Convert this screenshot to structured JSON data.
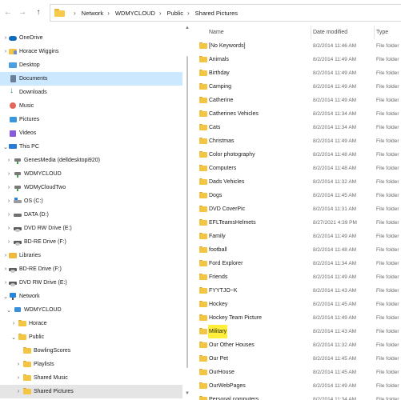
{
  "address_bar": {
    "back_icon": "back-arrow-icon",
    "forward_icon": "forward-arrow-icon",
    "up_icon": "up-arrow-icon",
    "crumbs": [
      "Network",
      "WDMYCLOUD",
      "Public",
      "Shared Pictures"
    ]
  },
  "navigation": {
    "items": [
      {
        "label": "OneDrive",
        "icon": "onedrive-icon"
      },
      {
        "label": "Horace Wiggins",
        "icon": "user-folder-icon"
      },
      {
        "label": "Desktop",
        "icon": "desktop-icon"
      },
      {
        "label": "Documents",
        "icon": "documents-icon"
      },
      {
        "label": "Downloads",
        "icon": "downloads-icon"
      },
      {
        "label": "Music",
        "icon": "music-icon"
      },
      {
        "label": "Pictures",
        "icon": "pictures-icon"
      },
      {
        "label": "Videos",
        "icon": "videos-icon"
      },
      {
        "label": "This PC",
        "icon": "this-pc-icon"
      },
      {
        "label": "GenesMedia (delldesktopi920)",
        "icon": "network-drive-icon"
      },
      {
        "label": "WDMYCLOUD",
        "icon": "network-drive-icon"
      },
      {
        "label": "WDMyCloudTwo",
        "icon": "network-drive-icon"
      },
      {
        "label": "OS (C:)",
        "icon": "os-drive-icon"
      },
      {
        "label": "DATA (D:)",
        "icon": "drive-icon"
      },
      {
        "label": "DVD RW Drive (E:)",
        "icon": "dvd-drive-icon"
      },
      {
        "label": "BD-RE Drive (F:)",
        "icon": "dvd-drive-icon"
      },
      {
        "label": "Libraries",
        "icon": "libraries-icon"
      },
      {
        "label": "BD-RE Drive (F:)",
        "icon": "dvd-drive-icon"
      },
      {
        "label": "DVD RW Drive (E:)",
        "icon": "dvd-drive-icon"
      },
      {
        "label": "Network",
        "icon": "network-icon"
      },
      {
        "label": "WDMYCLOUD",
        "icon": "computer-icon"
      },
      {
        "label": "Horace",
        "icon": "folder-icon"
      },
      {
        "label": "Public",
        "icon": "folder-icon"
      },
      {
        "label": "BowlingScores",
        "icon": "folder-icon"
      },
      {
        "label": "Playlists",
        "icon": "folder-icon"
      },
      {
        "label": "Shared Music",
        "icon": "folder-icon"
      },
      {
        "label": "Shared Pictures",
        "icon": "folder-icon"
      }
    ]
  },
  "content": {
    "columns": {
      "name": "Name",
      "date": "Date modified",
      "type": "Type"
    },
    "files": [
      {
        "name": "[No Keywords]",
        "date": "8/2/2014 11:46 AM",
        "type": "File folder"
      },
      {
        "name": "Animals",
        "date": "8/2/2014 11:49 AM",
        "type": "File folder"
      },
      {
        "name": "Birthday",
        "date": "8/2/2014 11:49 AM",
        "type": "File folder"
      },
      {
        "name": "Camping",
        "date": "8/2/2014 11:49 AM",
        "type": "File folder"
      },
      {
        "name": "Catherine",
        "date": "8/2/2014 11:49 AM",
        "type": "File folder"
      },
      {
        "name": "Catherines Vehicles",
        "date": "8/2/2014 11:34 AM",
        "type": "File folder"
      },
      {
        "name": "Cats",
        "date": "8/2/2014 11:34 AM",
        "type": "File folder"
      },
      {
        "name": "Christmas",
        "date": "8/2/2014 11:49 AM",
        "type": "File folder"
      },
      {
        "name": "Color photography",
        "date": "8/2/2014 11:48 AM",
        "type": "File folder"
      },
      {
        "name": "Computers",
        "date": "8/2/2014 11:48 AM",
        "type": "File folder"
      },
      {
        "name": "Dads Vehicles",
        "date": "8/2/2014 11:32 AM",
        "type": "File folder"
      },
      {
        "name": "Dogs",
        "date": "8/2/2014 11:45 AM",
        "type": "File folder"
      },
      {
        "name": "DVD CoverPic",
        "date": "8/2/2014 11:31 AM",
        "type": "File folder"
      },
      {
        "name": "EFLTeamsHelmets",
        "date": "8/27/2021 4:39 PM",
        "type": "File folder"
      },
      {
        "name": "Family",
        "date": "8/2/2014 11:49 AM",
        "type": "File folder"
      },
      {
        "name": "football",
        "date": "8/2/2014 11:48 AM",
        "type": "File folder"
      },
      {
        "name": "Ford Explorer",
        "date": "8/2/2014 11:34 AM",
        "type": "File folder"
      },
      {
        "name": "Friends",
        "date": "8/2/2014 11:49 AM",
        "type": "File folder"
      },
      {
        "name": "FYYTJO~K",
        "date": "8/2/2014 11:43 AM",
        "type": "File folder"
      },
      {
        "name": "Hockey",
        "date": "8/2/2014 11:45 AM",
        "type": "File folder"
      },
      {
        "name": "Hockey Team Picture",
        "date": "8/2/2014 11:49 AM",
        "type": "File folder"
      },
      {
        "name": "Military",
        "date": "8/2/2014 11:43 AM",
        "type": "File folder",
        "highlighted": true
      },
      {
        "name": "Our Other Houses",
        "date": "8/2/2014 11:32 AM",
        "type": "File folder"
      },
      {
        "name": "Our Pet",
        "date": "8/2/2014 11:45 AM",
        "type": "File folder"
      },
      {
        "name": "OurHouse",
        "date": "8/2/2014 11:45 AM",
        "type": "File folder"
      },
      {
        "name": "OurWebPages",
        "date": "8/2/2014 11:49 AM",
        "type": "File folder"
      },
      {
        "name": "Personal computers",
        "date": "8/2/2014 11:34 AM",
        "type": "File folder"
      }
    ]
  },
  "colors": {
    "selection": "#cce8ff",
    "current_item": "#e5e5e5",
    "highlight": "#ffef3a",
    "folder": "#f4c542"
  }
}
